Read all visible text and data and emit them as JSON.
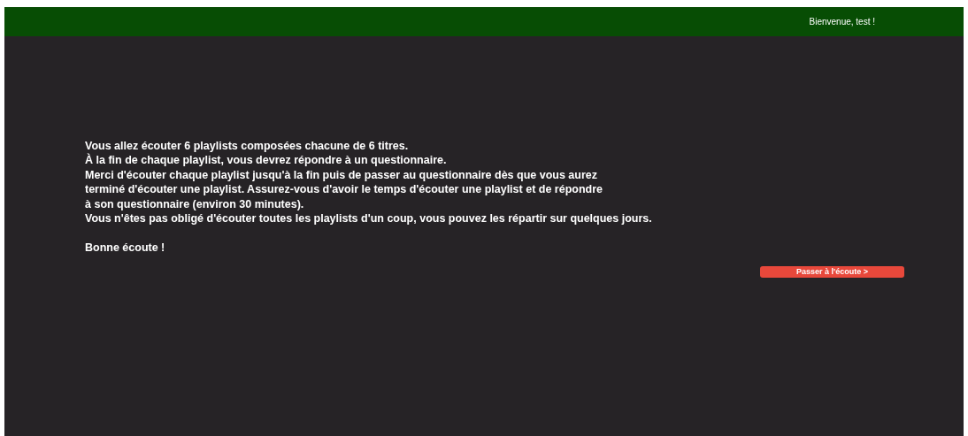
{
  "header": {
    "greeting": "Bienvenue, test !"
  },
  "intro": {
    "lines": [
      "Vous allez écouter 6 playlists composées chacune de 6 titres.",
      "À la fin de chaque playlist, vous devrez répondre à un questionnaire.",
      "Merci d'écouter chaque playlist jusqu'à la fin puis de passer au questionnaire dès que vous aurez",
      "terminé d'écouter une playlist. Assurez-vous d'avoir le temps d'écouter une playlist et de répondre",
      "à son questionnaire (environ 30 minutes).",
      "Vous n'êtes pas obligé d'écouter toutes les playlists d'un coup, vous pouvez les répartir sur quelques jours."
    ],
    "closing": "Bonne écoute !"
  },
  "button": {
    "label": "Passer à l'écoute >"
  }
}
